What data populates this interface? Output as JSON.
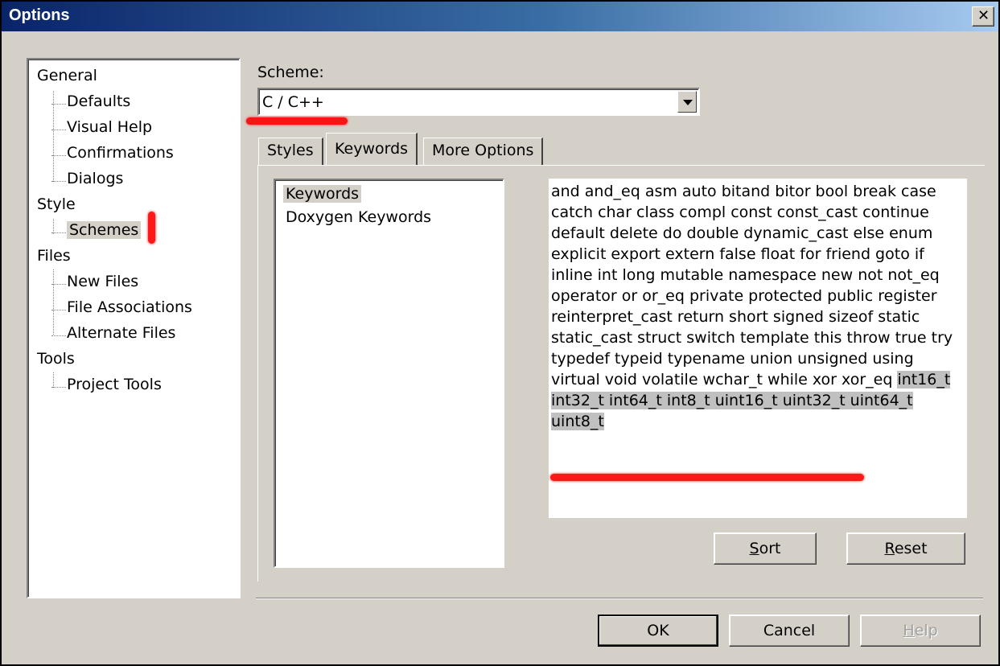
{
  "window": {
    "title": "Options",
    "close_glyph": "✕"
  },
  "tree": {
    "items": [
      {
        "label": "General",
        "level": 0
      },
      {
        "label": "Defaults",
        "level": 1
      },
      {
        "label": "Visual Help",
        "level": 1
      },
      {
        "label": "Confirmations",
        "level": 1
      },
      {
        "label": "Dialogs",
        "level": 1
      },
      {
        "label": "Style",
        "level": 0
      },
      {
        "label": "Schemes",
        "level": 1,
        "selected": true
      },
      {
        "label": "Files",
        "level": 0
      },
      {
        "label": "New Files",
        "level": 1
      },
      {
        "label": "File Associations",
        "level": 1
      },
      {
        "label": "Alternate Files",
        "level": 1
      },
      {
        "label": "Tools",
        "level": 0
      },
      {
        "label": "Project Tools",
        "level": 1
      }
    ]
  },
  "scheme": {
    "label": "Scheme:",
    "selected": "C / C++"
  },
  "tabs": [
    {
      "label": "Styles",
      "active": false
    },
    {
      "label": "Keywords",
      "active": true
    },
    {
      "label": "More Options",
      "active": false
    }
  ],
  "keyword_sets": {
    "items": [
      {
        "label": "Keywords",
        "selected": true
      },
      {
        "label": "Doxygen Keywords",
        "selected": false
      }
    ]
  },
  "keywords_text": {
    "plain": "and and_eq asm auto bitand bitor bool break case catch char class compl const const_cast continue default delete do double dynamic_cast else enum explicit export extern false float for friend goto if inline int long mutable namespace new not not_eq operator or or_eq private protected public register reinterpret_cast return short signed sizeof static static_cast struct switch template this throw true try typedef typeid typename union unsigned using virtual void volatile wchar_t while xor xor_eq",
    "highlighted": "int16_t int32_t int64_t int8_t uint16_t uint32_t uint64_t uint8_t"
  },
  "buttons": {
    "sort": {
      "label": "Sort",
      "access_key": "S",
      "rest": "ort"
    },
    "reset": {
      "label": "Reset",
      "access_key": "R",
      "rest": "eset"
    },
    "ok": "OK",
    "cancel": "Cancel",
    "help": {
      "label": "Help",
      "access_key": "H",
      "rest": "elp",
      "disabled": true
    }
  },
  "colors": {
    "title_gradient_start": "#0a246a",
    "title_gradient_end": "#a6caf0",
    "dialog_bg": "#d4d0c8",
    "annotation": "#ff0000"
  }
}
